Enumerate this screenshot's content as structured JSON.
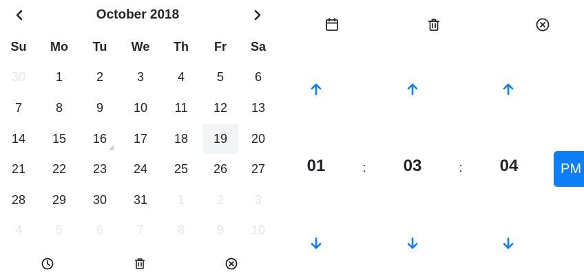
{
  "calendar": {
    "title": "October 2018",
    "prev_icon": "chevron-left-icon",
    "next_icon": "chevron-right-icon",
    "weekdays": [
      "Su",
      "Mo",
      "Tu",
      "We",
      "Th",
      "Fr",
      "Sa"
    ],
    "weeks": [
      [
        {
          "d": "30",
          "m": true
        },
        {
          "d": "1"
        },
        {
          "d": "2"
        },
        {
          "d": "3"
        },
        {
          "d": "4"
        },
        {
          "d": "5"
        },
        {
          "d": "6"
        }
      ],
      [
        {
          "d": "7"
        },
        {
          "d": "8"
        },
        {
          "d": "9"
        },
        {
          "d": "10"
        },
        {
          "d": "11"
        },
        {
          "d": "12"
        },
        {
          "d": "13"
        }
      ],
      [
        {
          "d": "14"
        },
        {
          "d": "15"
        },
        {
          "d": "16",
          "selected": true
        },
        {
          "d": "17"
        },
        {
          "d": "18"
        },
        {
          "d": "19",
          "today": true
        },
        {
          "d": "20"
        }
      ],
      [
        {
          "d": "21"
        },
        {
          "d": "22"
        },
        {
          "d": "23"
        },
        {
          "d": "24"
        },
        {
          "d": "25"
        },
        {
          "d": "26"
        },
        {
          "d": "27"
        }
      ],
      [
        {
          "d": "28"
        },
        {
          "d": "29"
        },
        {
          "d": "30"
        },
        {
          "d": "31"
        },
        {
          "d": "1",
          "m": true
        },
        {
          "d": "2",
          "m": true
        },
        {
          "d": "3",
          "m": true
        }
      ],
      [
        {
          "d": "4",
          "m": true
        },
        {
          "d": "5",
          "m": true
        },
        {
          "d": "6",
          "m": true
        },
        {
          "d": "7",
          "m": true
        },
        {
          "d": "8",
          "m": true
        },
        {
          "d": "9",
          "m": true
        },
        {
          "d": "10",
          "m": true
        }
      ]
    ],
    "footer_icons": [
      "clock-icon",
      "trash-icon",
      "close-circle-icon"
    ]
  },
  "time": {
    "header_icons": [
      "calendar-icon",
      "trash-icon",
      "close-circle-icon"
    ],
    "hour": "01",
    "minute": "03",
    "second": "04",
    "separator": ":",
    "meridiem": "PM"
  },
  "colors": {
    "accent": "#0d7ef5",
    "text": "#212529",
    "muted": "#e4e6e8",
    "today_bg": "#f3f4f6"
  }
}
